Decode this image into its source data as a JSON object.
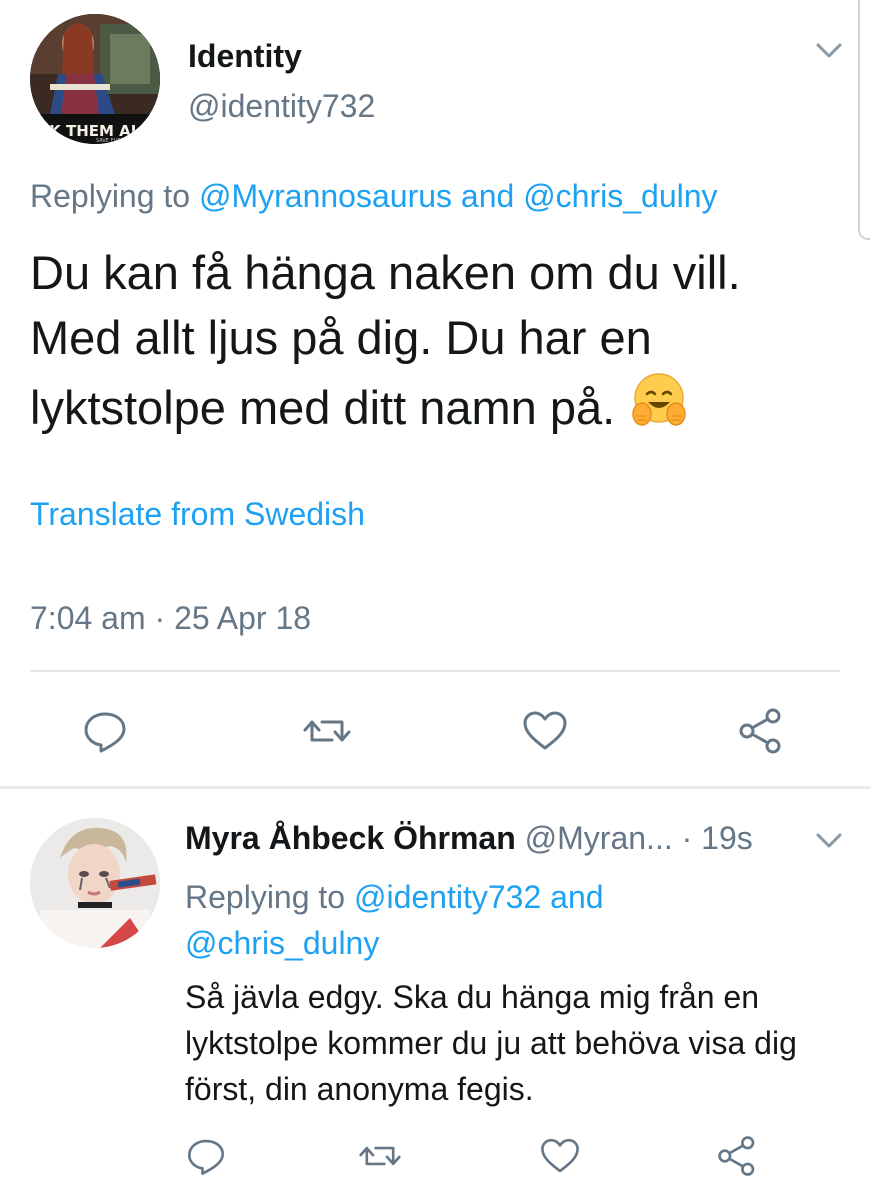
{
  "main_tweet": {
    "author_name": "Identity",
    "author_handle": "@identity732",
    "avatar_banner_text": "ILK THEM AL",
    "avatar_sub_text": "SAVE EUROPE",
    "replying_prefix": "Replying to ",
    "replying_mention_1": "@Myrannosaurus",
    "replying_and": " and ",
    "replying_mention_2": "@chris_dulny",
    "text": "Du kan få hänga naken om du vill. Med allt ljus på dig. Du har en lyktstolpe med ditt namn på.",
    "emoji": "hugging-face-emoji",
    "translate_label": "Translate from Swedish",
    "timestamp": "7:04 am · 25 Apr 18"
  },
  "reply_tweet": {
    "author_name": "Myra Åhbeck Öhrman",
    "author_handle": "@Myran...",
    "time_sep": " · ",
    "time_ago": "19s",
    "replying_prefix": "Replying to ",
    "replying_mention_1": "@identity732",
    "replying_and": " and ",
    "replying_mention_2": "@chris_dulny",
    "text": "Så jävla edgy. Ska du hänga mig från en lyktstolpe kommer du ju att behöva visa dig först, din anonyma fegis."
  },
  "icons": [
    "chevron-down-icon",
    "reply-icon",
    "retweet-icon",
    "like-icon",
    "share-icon"
  ],
  "colors": {
    "link_blue": "#1da1f2",
    "secondary_gray": "#657786",
    "text_dark": "#14171a",
    "divider": "#e1e8ed",
    "icon_gray": "#657786"
  }
}
